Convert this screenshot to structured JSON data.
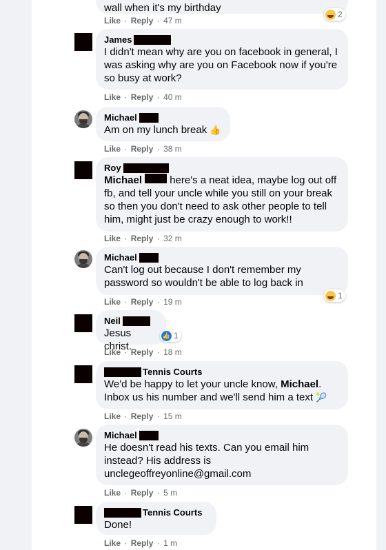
{
  "actions": {
    "like": "Like",
    "reply": "Reply",
    "sep": "·"
  },
  "comments": [
    {
      "author": "",
      "text": "wall when it's my birthday",
      "time": "47 m",
      "reaction": {
        "icon": "haha",
        "count": "2"
      }
    },
    {
      "author": "James",
      "text": "I didn't mean why are you on facebook in general, I was asking why are you on Facebook now if you're so busy at work?",
      "time": "40 m"
    },
    {
      "author": "Michael",
      "text": "Am on my lunch break",
      "emoji": "👍",
      "time": "38 m"
    },
    {
      "author": "Roy",
      "mention": "Michael",
      "text": " here's a neat idea, maybe log out off fb, and tell your uncle while you still on your break so then you don't need to ask other people to tell him, might just be crazy enough to work!!",
      "time": "32 m"
    },
    {
      "author": "Michael",
      "text": "Can't log out because I don't remember my password so wouldn't be able to log back in",
      "time": "19 m",
      "reaction": {
        "icon": "haha",
        "count": "1"
      }
    },
    {
      "author": "Neil",
      "text": "Jesus christ.",
      "time": "18 m",
      "reaction": {
        "icon": "like",
        "count": "1"
      }
    },
    {
      "author": "Tennis Courts",
      "text_before": "We'd be happy to let your uncle know, ",
      "mention": "Michael",
      "text_after": ". Inbox us his number and we'll send him a text",
      "emoji": "🎾",
      "time": "15 m"
    },
    {
      "author": "Michael",
      "text": "He doesn't read his texts. Can you email him instead? His address is unclegeoffreyonline@gmail.com",
      "time": "5 m"
    },
    {
      "author": "Tennis Courts",
      "text": "Done!",
      "time": "1 m"
    }
  ]
}
